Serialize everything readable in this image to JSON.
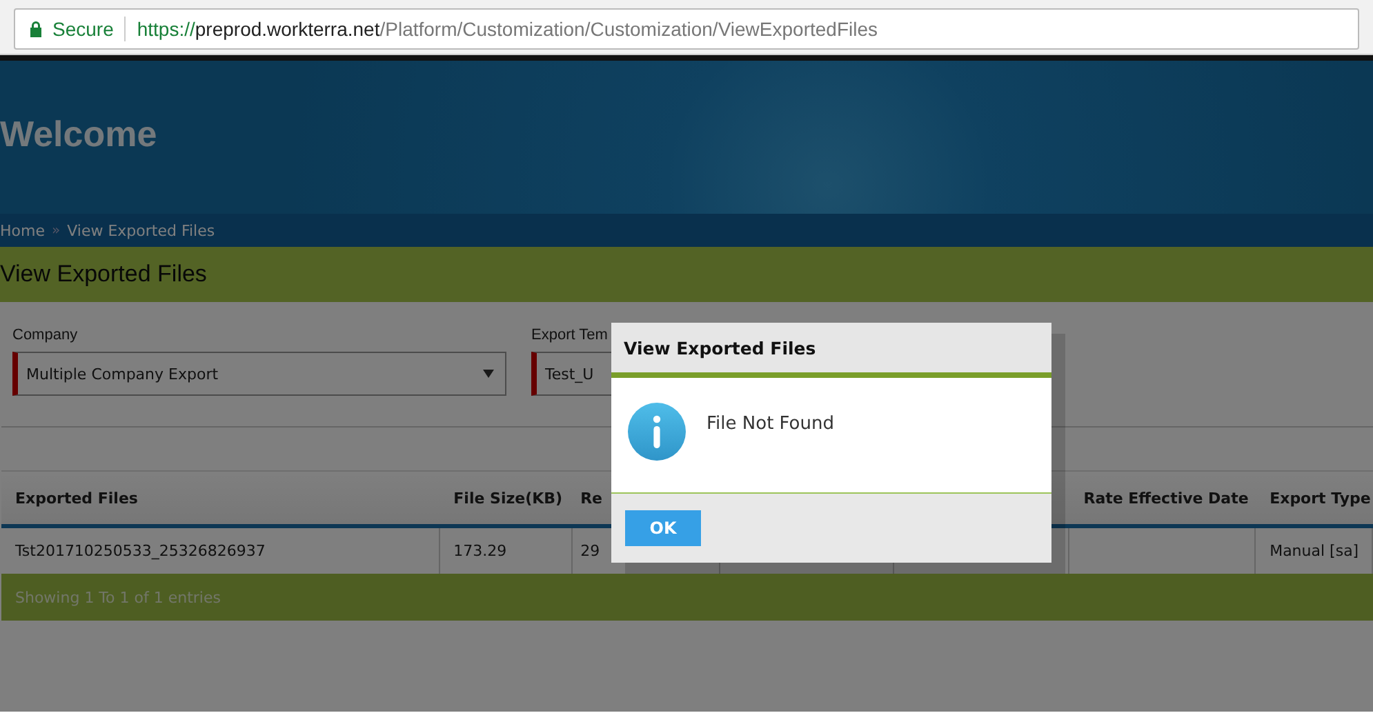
{
  "address_bar": {
    "security": "Secure",
    "url_scheme": "https://",
    "url_host": "preprod.workterra.net",
    "url_path": "/Platform/Customization/Customization/ViewExportedFiles"
  },
  "banner": {
    "title": "Welcome"
  },
  "breadcrumb": {
    "items": [
      "Home",
      "View Exported Files"
    ],
    "separator": "»"
  },
  "page_title": "View Exported Files",
  "filters": [
    {
      "label": "Company",
      "value": "Multiple Company Export",
      "kind": "dropdown"
    },
    {
      "label": "Export Tem",
      "value": "Test_U",
      "kind": "text"
    }
  ],
  "table": {
    "columns": [
      {
        "label": "Exported Files"
      },
      {
        "label": "File Size(KB)"
      },
      {
        "label": "Re"
      },
      {},
      {},
      {
        "label": "Rate Effective Date"
      },
      {
        "label": "Export Type"
      }
    ],
    "rows": [
      {
        "cells": [
          {
            "text": "Tst201710250533_25326826937"
          },
          {
            "text": "173.29"
          },
          {
            "text": "29"
          },
          {},
          {},
          {},
          {
            "text": "Manual [sa]"
          }
        ]
      }
    ],
    "footer": "Showing 1 To 1 of 1 entries"
  },
  "dialog": {
    "title": "View Exported Files",
    "message": "File Not Found",
    "buttons": [
      "OK"
    ]
  }
}
